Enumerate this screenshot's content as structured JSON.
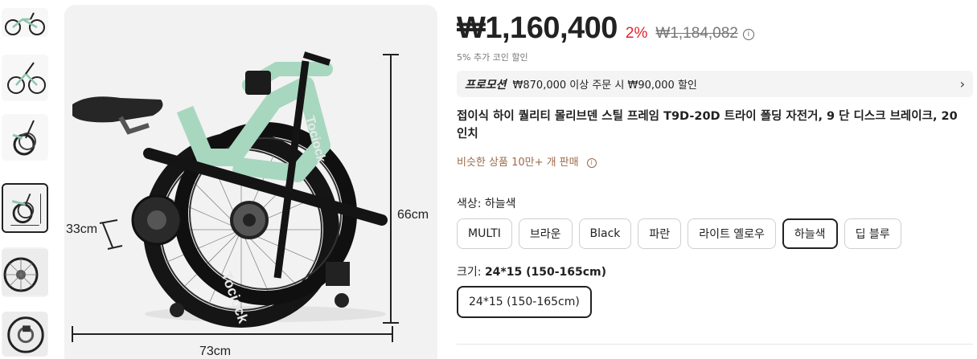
{
  "thumbnails": [
    {
      "alt": "thumbnail-1"
    },
    {
      "alt": "thumbnail-2"
    },
    {
      "alt": "thumbnail-3"
    },
    {
      "alt": "thumbnail-4",
      "selected": true
    },
    {
      "alt": "thumbnail-5"
    },
    {
      "alt": "thumbnail-6"
    }
  ],
  "main_image": {
    "dim_height": "66cm",
    "dim_width": "73cm",
    "dim_depth": "33cm",
    "frame_color": "#a8d7c0",
    "brand_text": "Tociock"
  },
  "price": {
    "current": "₩1,160,400",
    "discount": "2%",
    "original": "₩1,184,082",
    "info_icon": "i",
    "coin_note": "5% 추가 코인 할인"
  },
  "promo": {
    "tag": "프로모션",
    "text": "₩870,000 이상 주문 시 ₩90,000 할인",
    "chevron": "›"
  },
  "product_title": "접이식 하이 퀄리티 몰리브덴 스틸 프레임 T9D-20D 트라이 폴딩 자전거, 9 단 디스크 브레이크, 20 인치",
  "similar_sold": "비슷한 상품 10만+ 개 판매",
  "color": {
    "label": "색상: 하늘색",
    "options": [
      "MULTI",
      "브라운",
      "Black",
      "파란",
      "라이트 옐로우",
      "하늘색",
      "딥 블루"
    ],
    "selected_index": 5
  },
  "size": {
    "label_prefix": "크기: ",
    "label_value": "24*15 (150-165cm)",
    "options": [
      "24*15 (150-165cm)"
    ],
    "selected_index": 0
  },
  "colors": {
    "accent_red": "#e0222d",
    "similar_brown": "#9c6a4a",
    "selected_border": "#222222"
  }
}
